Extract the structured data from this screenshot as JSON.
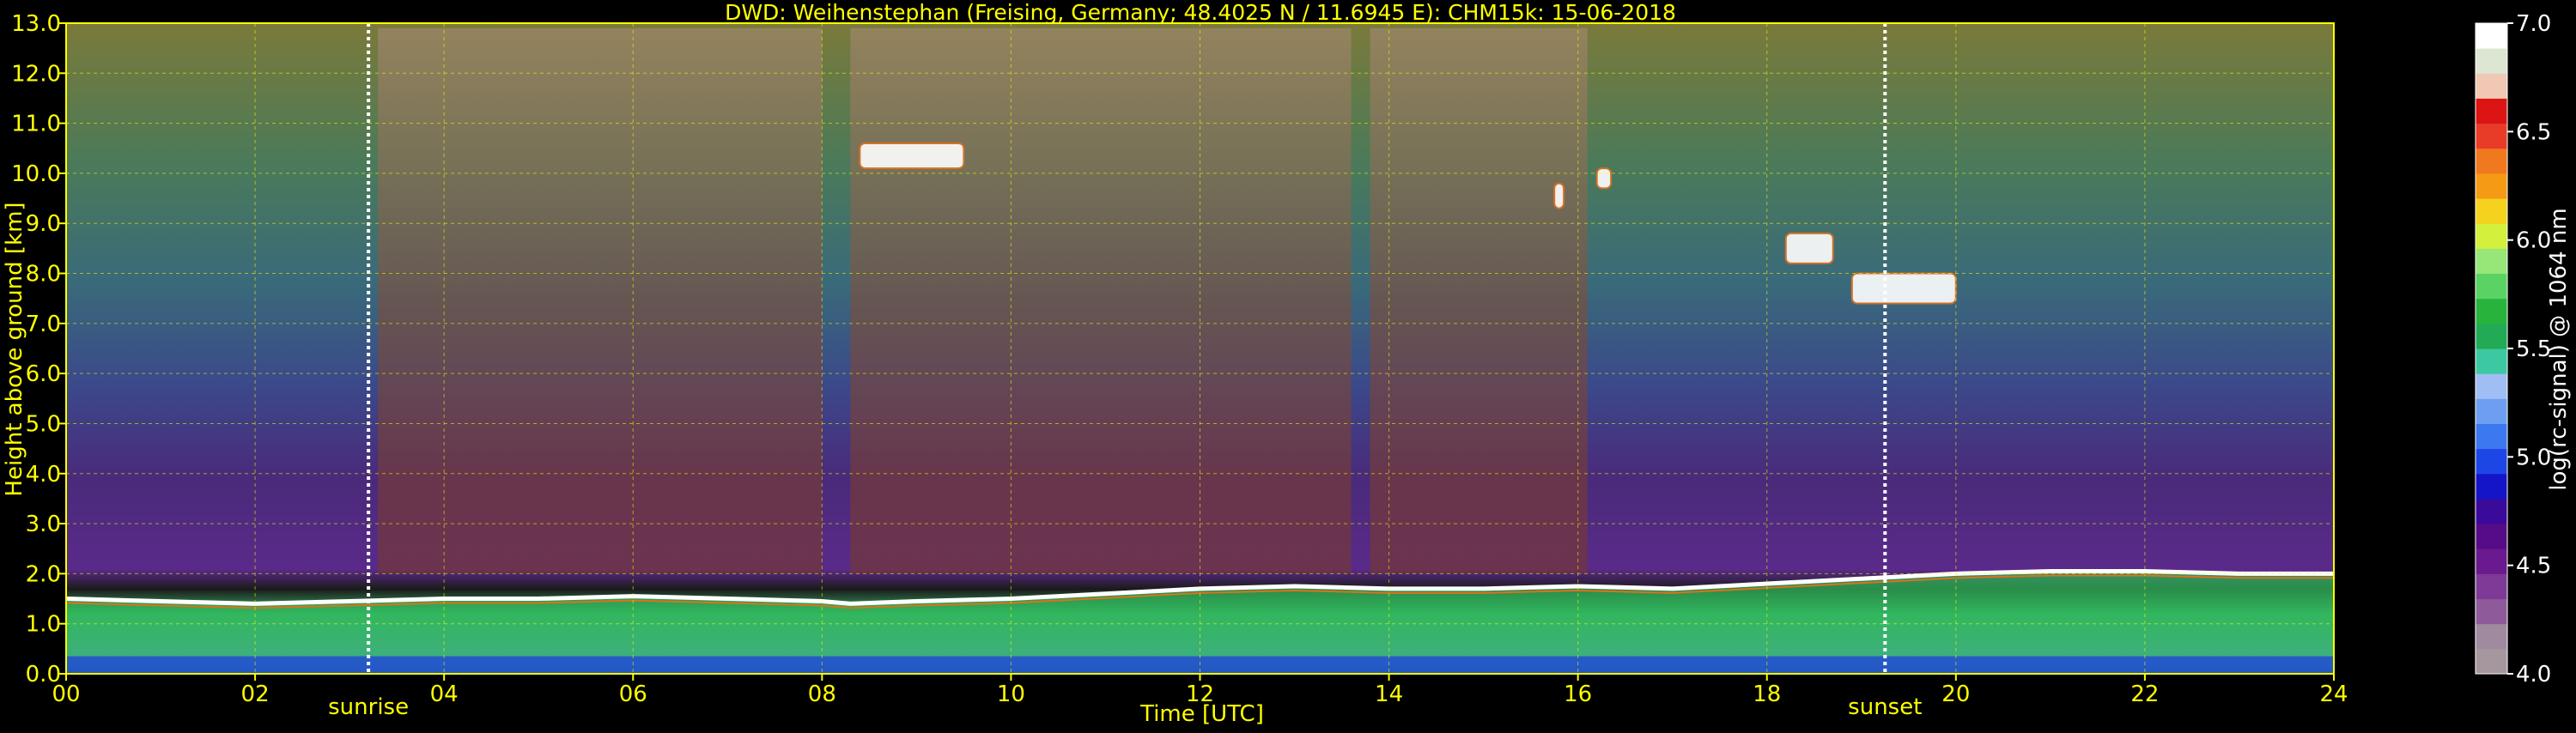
{
  "chart_data": {
    "type": "heatmap",
    "title": "DWD: Weihenstephan (Freising, Germany; 48.4025 N / 11.6945 E):    CHM15k: 15-06-2018",
    "xlabel": "Time [UTC]",
    "ylabel": "Height above ground [km]",
    "xlim": [
      0,
      24
    ],
    "ylim": [
      0,
      13
    ],
    "x_ticks": [
      "00",
      "02",
      "04",
      "06",
      "08",
      "10",
      "12",
      "14",
      "16",
      "18",
      "20",
      "22",
      "24"
    ],
    "y_ticks": [
      "0.0",
      "1.0",
      "2.0",
      "3.0",
      "4.0",
      "5.0",
      "6.0",
      "7.0",
      "8.0",
      "9.0",
      "10.0",
      "11.0",
      "12.0",
      "13.0"
    ],
    "grid": true,
    "colorbar": {
      "label": "log(rc-signal) @ 1064 nm",
      "range": [
        4.0,
        7.0
      ],
      "ticks": [
        "4.0",
        "4.5",
        "5.0",
        "5.5",
        "6.0",
        "6.5",
        "7.0"
      ],
      "colors": [
        "#a6969e",
        "#a08aa0",
        "#8e5a9a",
        "#7e3a96",
        "#6a1a8e",
        "#560c86",
        "#3a0a9a",
        "#1414c8",
        "#1e46e6",
        "#3c78f0",
        "#6e9ef2",
        "#a0bef4",
        "#3cc8a0",
        "#22aa55",
        "#28b43c",
        "#5ad264",
        "#96e678",
        "#d2f03c",
        "#f5d21e",
        "#f59a14",
        "#f0781e",
        "#e83c28",
        "#dc1414",
        "#f0c8b4",
        "#dce6d2",
        "#ffffff"
      ]
    },
    "annotations": [
      {
        "text": "sunrise",
        "x": 3.2
      },
      {
        "text": "sunset",
        "x": 19.25
      }
    ],
    "layers": [
      {
        "name": "boundary layer top",
        "x": [
          0,
          1,
          2,
          3,
          4,
          5,
          6,
          7,
          8,
          8.3,
          9,
          10,
          11,
          12,
          13,
          14,
          15,
          16,
          17,
          18,
          19,
          20,
          21,
          22,
          23,
          24
        ],
        "y": [
          1.5,
          1.45,
          1.4,
          1.45,
          1.5,
          1.5,
          1.55,
          1.5,
          1.45,
          1.4,
          1.45,
          1.5,
          1.6,
          1.7,
          1.75,
          1.7,
          1.7,
          1.75,
          1.7,
          1.8,
          1.9,
          2.0,
          2.05,
          2.05,
          2.0,
          2.0
        ]
      }
    ],
    "clouds": [
      {
        "x": [
          8.4,
          9.5
        ],
        "y": [
          10.1,
          10.6
        ]
      },
      {
        "x": [
          15.75,
          15.85
        ],
        "y": [
          9.3,
          9.8
        ]
      },
      {
        "x": [
          16.2,
          16.35
        ],
        "y": [
          9.7,
          10.1
        ]
      },
      {
        "x": [
          18.2,
          18.7
        ],
        "y": [
          8.2,
          8.8
        ]
      },
      {
        "x": [
          18.9,
          20.0
        ],
        "y": [
          7.4,
          8.0
        ]
      }
    ]
  }
}
